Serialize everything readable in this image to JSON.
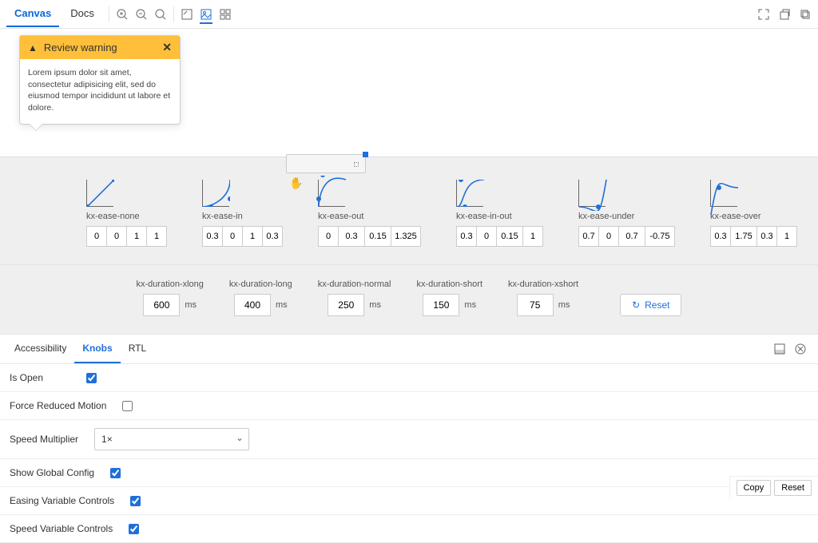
{
  "toolbar": {
    "tabs": [
      {
        "label": "Canvas",
        "active": true
      },
      {
        "label": "Docs",
        "active": false
      }
    ]
  },
  "warning": {
    "title": "Review warning",
    "body": "Lorem ipsum dolor sit amet, consectetur adipisicing elit, sed do eiusmod tempor incididunt ut labore et dolore."
  },
  "easings": [
    {
      "name": "kx-ease-none",
      "values": [
        "0",
        "0",
        "1",
        "1"
      ]
    },
    {
      "name": "kx-ease-in",
      "values": [
        "0.3",
        "0",
        "1",
        "0.3"
      ]
    },
    {
      "name": "kx-ease-out",
      "values": [
        "0",
        "0.3",
        "0.15",
        "1.325"
      ]
    },
    {
      "name": "kx-ease-in-out",
      "values": [
        "0.3",
        "0",
        "0.15",
        "1"
      ]
    },
    {
      "name": "kx-ease-under",
      "values": [
        "0.7",
        "0",
        "0.7",
        "-0.75"
      ]
    },
    {
      "name": "kx-ease-over",
      "values": [
        "0.3",
        "1.75",
        "0.3",
        "1"
      ]
    }
  ],
  "durations": [
    {
      "name": "kx-duration-xlong",
      "value": "600",
      "unit": "ms"
    },
    {
      "name": "kx-duration-long",
      "value": "400",
      "unit": "ms"
    },
    {
      "name": "kx-duration-normal",
      "value": "250",
      "unit": "ms"
    },
    {
      "name": "kx-duration-short",
      "value": "150",
      "unit": "ms"
    },
    {
      "name": "kx-duration-xshort",
      "value": "75",
      "unit": "ms"
    }
  ],
  "reset_label": "Reset",
  "addons": {
    "tabs": [
      {
        "label": "Accessibility",
        "active": false
      },
      {
        "label": "Knobs",
        "active": true
      },
      {
        "label": "RTL",
        "active": false
      }
    ]
  },
  "knobs": [
    {
      "label": "Is Open",
      "type": "checkbox",
      "checked": true
    },
    {
      "label": "Force Reduced Motion",
      "type": "checkbox",
      "checked": false
    },
    {
      "label": "Speed Multiplier",
      "type": "select",
      "value": "1×"
    },
    {
      "label": "Show Global Config",
      "type": "checkbox",
      "checked": true
    },
    {
      "label": "Easing Variable Controls",
      "type": "checkbox",
      "checked": true
    },
    {
      "label": "Speed Variable Controls",
      "type": "checkbox",
      "checked": true
    }
  ],
  "footer": {
    "copy": "Copy",
    "reset": "Reset"
  }
}
